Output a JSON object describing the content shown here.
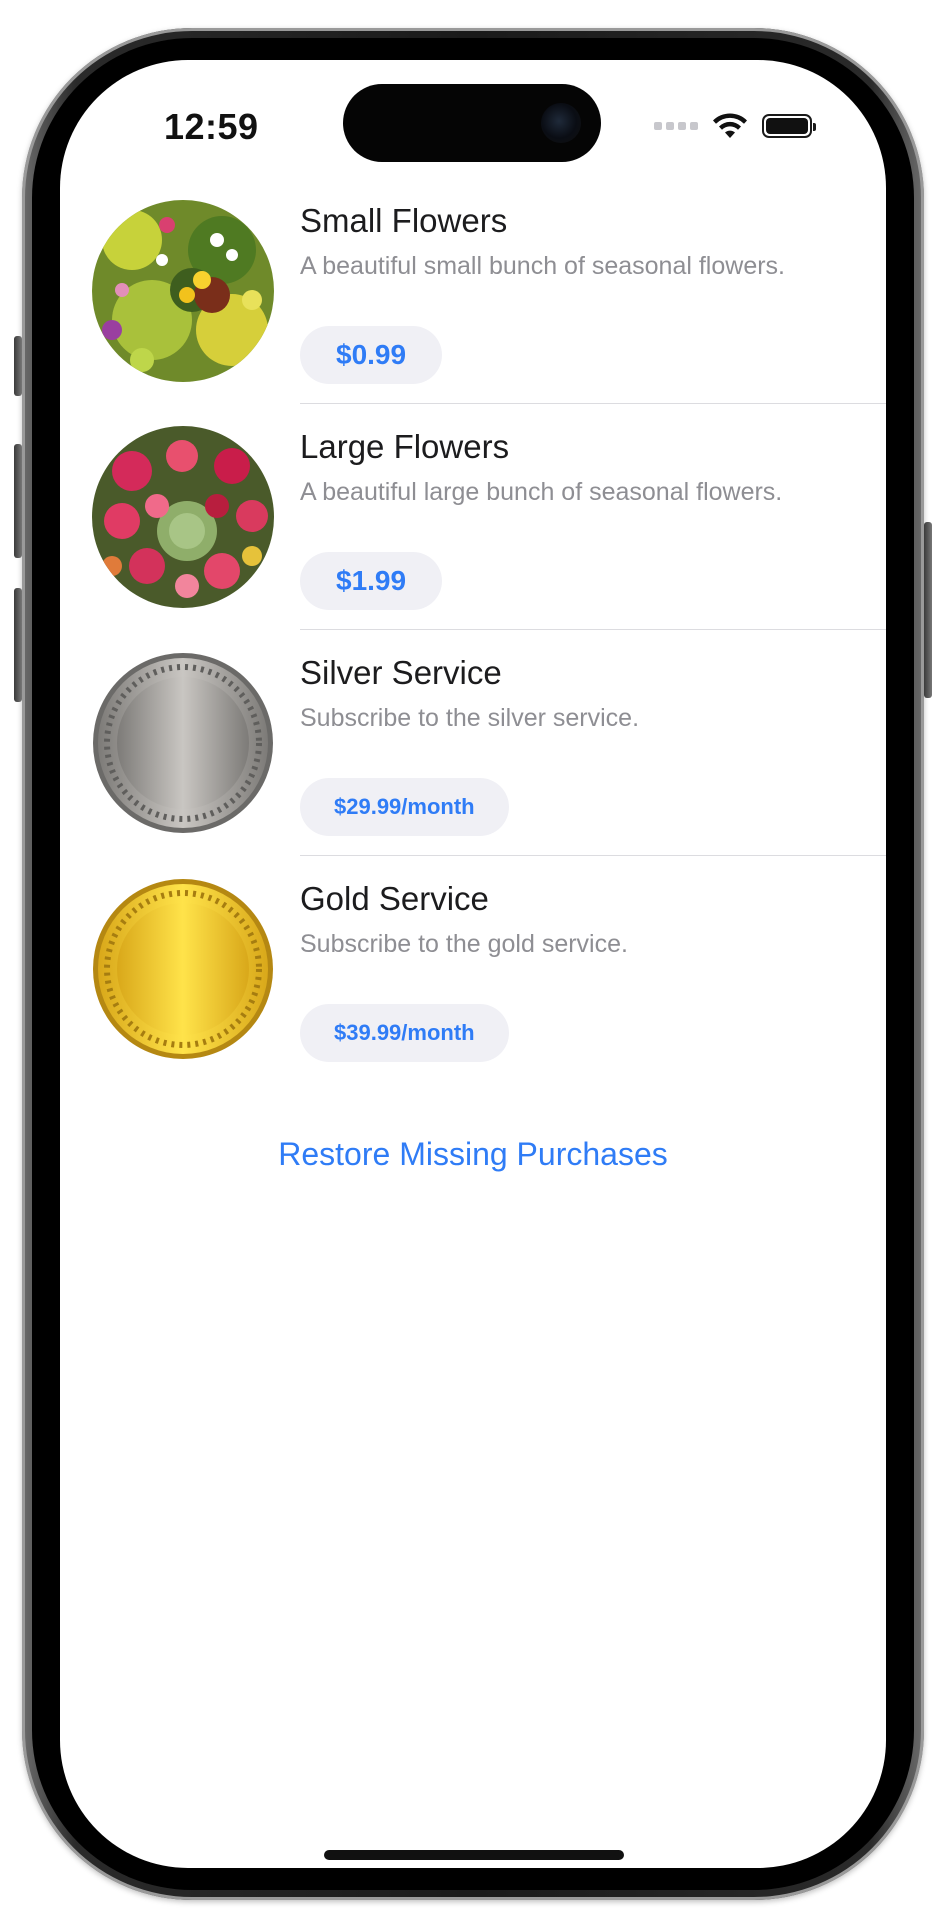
{
  "status_bar": {
    "time": "12:59"
  },
  "products": [
    {
      "title": "Small Flowers",
      "description": "A beautiful small bunch of seasonal flowers.",
      "price": "$0.99",
      "image": "flowers-small"
    },
    {
      "title": "Large Flowers",
      "description": "A beautiful large bunch of seasonal flowers.",
      "price": "$1.99",
      "image": "flowers-large"
    },
    {
      "title": "Silver Service",
      "description": "Subscribe to the silver service.",
      "price": "$29.99/month",
      "image": "silver-medal"
    },
    {
      "title": "Gold Service",
      "description": "Subscribe to the gold service.",
      "price": "$39.99/month",
      "image": "gold-medal"
    }
  ],
  "restore_label": "Restore Missing Purchases",
  "colors": {
    "accent": "#2f7cf6",
    "price_background": "#f0f0f5",
    "secondary_text": "#8e8e93"
  }
}
